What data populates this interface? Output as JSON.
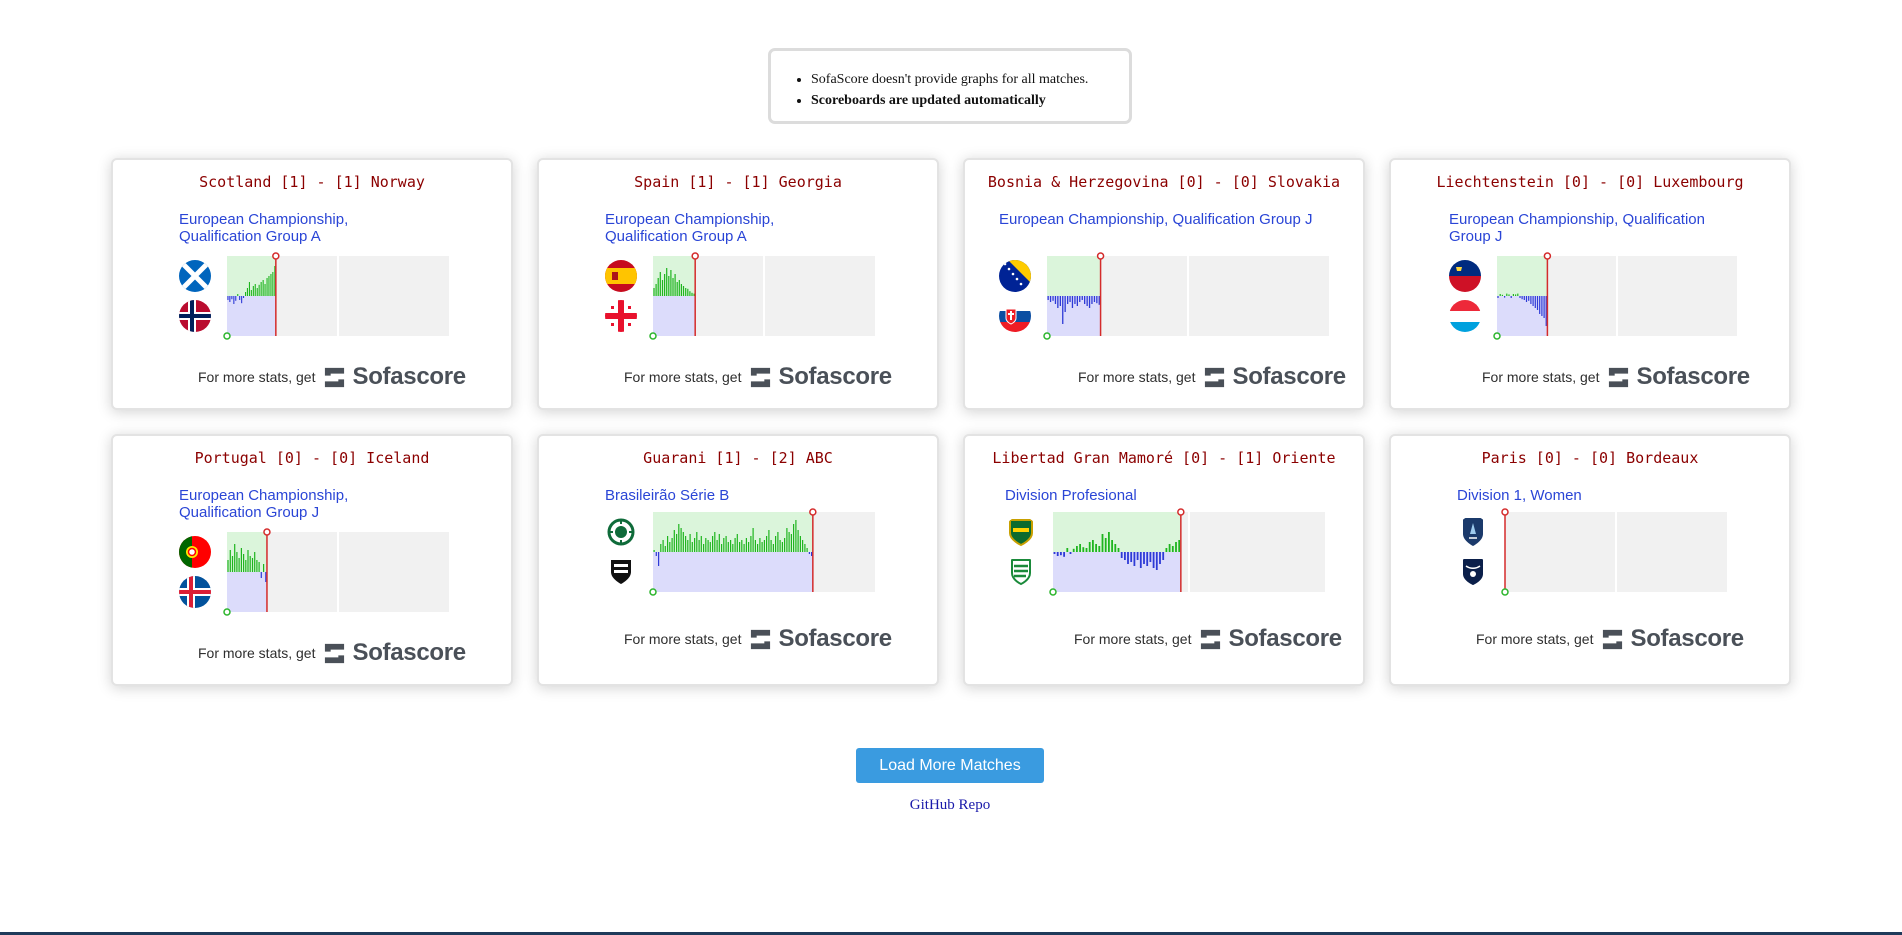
{
  "notice": {
    "items": [
      "SofaScore doesn't provide graphs for all matches.",
      "Scoreboards are updated automatically"
    ]
  },
  "promo": {
    "text": "For more stats, get",
    "brand": "Sofascore"
  },
  "colors": {
    "title": "#8b0000",
    "league": "#2a45d6",
    "home_bars": "#1fb51f",
    "away_bars": "#2e3bd6",
    "home_zone": "#dbf5db",
    "away_zone": "#dcdcfb",
    "marker": "#d42b2b",
    "start": "#2cb52c"
  },
  "matches": [
    {
      "title": "Scotland [1] - [1] Norway",
      "league": "European Championship, Qualification Group A",
      "home_icon": "scotland-flag-icon",
      "away_icon": "norway-flag-icon",
      "progress": 0.22,
      "bars": [
        -0.1,
        -0.15,
        -0.08,
        -0.2,
        -0.12,
        0.05,
        -0.1,
        -0.18,
        -0.05,
        0.1,
        0.2,
        0.35,
        0.15,
        0.25,
        0.3,
        0.2,
        0.28,
        0.35,
        0.4,
        0.3,
        0.45,
        0.5,
        0.55,
        0.6,
        0.75
      ]
    },
    {
      "title": "Spain [1] - [1] Georgia",
      "league": "European Championship, Qualification Group A",
      "home_icon": "spain-flag-icon",
      "away_icon": "georgia-flag-icon",
      "progress": 0.19,
      "bars": [
        0.2,
        0.3,
        0.45,
        0.6,
        0.4,
        0.55,
        0.7,
        0.5,
        0.65,
        0.45,
        0.55,
        0.35,
        0.4,
        0.3,
        0.25,
        0.2,
        0.18,
        0.12,
        0.08,
        0.06
      ]
    },
    {
      "title": "Bosnia & Herzegovina [0] - [0] Slovakia",
      "league": "European Championship, Qualification Group J",
      "home_icon": "bosnia-flag-icon",
      "away_icon": "slovakia-flag-icon",
      "progress": 0.19,
      "bars": [
        -0.1,
        -0.15,
        -0.12,
        -0.2,
        -0.3,
        -0.25,
        -0.7,
        -0.4,
        -0.2,
        -0.15,
        -0.3,
        -0.2,
        -0.25,
        -0.15,
        -0.1,
        -0.2,
        -0.25,
        -0.3,
        -0.2,
        -0.15,
        -0.18,
        -0.22
      ]
    },
    {
      "title": "Liechtenstein [0] - [0] Luxembourg",
      "league": "European Championship, Qualification Group J",
      "home_icon": "liechtenstein-flag-icon",
      "away_icon": "luxembourg-flag-icon",
      "progress": 0.21,
      "bars": [
        -0.05,
        0.05,
        0.03,
        -0.04,
        0.06,
        0.04,
        -0.05,
        0.05,
        0.04,
        0.06,
        -0.05,
        -0.08,
        -0.1,
        -0.15,
        -0.12,
        -0.2,
        -0.25,
        -0.3,
        -0.35,
        -0.45,
        -0.5,
        -0.55,
        -0.75
      ]
    },
    {
      "title": "Portugal [0] - [0] Iceland",
      "league": "European Championship, Qualification Group J",
      "home_icon": "portugal-flag-icon",
      "away_icon": "iceland-flag-icon",
      "progress": 0.18,
      "bars": [
        0.3,
        0.55,
        0.4,
        0.7,
        0.5,
        0.35,
        0.6,
        0.45,
        0.3,
        0.55,
        0.4,
        0.35,
        0.5,
        0.3,
        0.25,
        -0.15,
        0.2,
        -0.25
      ]
    },
    {
      "title": "Guarani [1] - [2] ABC",
      "league": "Brasileirão Série B",
      "home_icon": "guarani-crest-icon",
      "away_icon": "abc-crest-icon",
      "progress": 0.72,
      "bars": [
        0.05,
        -0.1,
        -0.35,
        0.2,
        0.3,
        0.15,
        0.4,
        0.25,
        0.35,
        0.55,
        0.45,
        0.7,
        0.6,
        0.5,
        0.4,
        0.3,
        0.45,
        0.25,
        0.35,
        0.5,
        0.3,
        0.4,
        0.2,
        0.35,
        0.3,
        0.25,
        0.4,
        0.5,
        0.3,
        0.45,
        0.2,
        0.35,
        0.4,
        0.25,
        0.3,
        0.2,
        0.35,
        0.45,
        0.25,
        0.3,
        0.2,
        0.35,
        0.25,
        0.4,
        0.6,
        0.3,
        0.2,
        0.35,
        0.25,
        0.3,
        0.4,
        0.55,
        0.3,
        0.2,
        0.4,
        0.5,
        0.3,
        0.25,
        0.35,
        0.6,
        0.5,
        0.45,
        0.7,
        0.8,
        0.55,
        0.4,
        0.3,
        0.2,
        0.1,
        -0.05,
        -0.1
      ]
    },
    {
      "title": "Libertad Gran Mamoré [0] - [1] Oriente",
      "league": "Division Profesional",
      "home_icon": "libertad-crest-icon",
      "away_icon": "oriente-crest-icon",
      "progress": 0.47,
      "bars": [
        -0.05,
        -0.1,
        -0.08,
        -0.12,
        0.1,
        -0.05,
        0.08,
        0.15,
        0.2,
        0.12,
        0.1,
        0.25,
        0.3,
        0.2,
        0.15,
        0.45,
        0.35,
        0.5,
        0.3,
        0.2,
        0.1,
        -0.15,
        -0.2,
        -0.3,
        -0.25,
        -0.35,
        -0.2,
        -0.4,
        -0.3,
        -0.35,
        -0.25,
        -0.4,
        -0.45,
        -0.3,
        -0.2,
        0.1,
        0.2,
        0.15,
        0.25,
        0.3
      ]
    },
    {
      "title": "Paris [0] - [0] Bordeaux",
      "league": "Division 1, Women",
      "home_icon": "paris-crest-icon",
      "away_icon": "bordeaux-crest-icon",
      "progress": 0.0,
      "bars": []
    }
  ],
  "load_more": "Load More Matches",
  "github": "GitHub Repo"
}
